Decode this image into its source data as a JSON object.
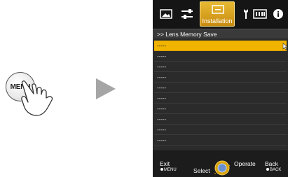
{
  "remote": {
    "menu_button_label": "MENU"
  },
  "osd": {
    "tabs": [
      {
        "icon": "picture-icon"
      },
      {
        "icon": "adjust-sliders-icon"
      },
      {
        "icon": "installation-icon",
        "label": "Installation",
        "active": true
      },
      {
        "icon": "wrench-icon"
      },
      {
        "icon": "display-icon"
      },
      {
        "icon": "info-icon"
      }
    ],
    "title": ">> Lens Memory Save",
    "rows": [
      "-----",
      "-----",
      "-----",
      "-----",
      "-----",
      "-----",
      "-----",
      "-----",
      "-----",
      "-----"
    ],
    "selected_index": 0,
    "footer": {
      "exit_label": "Exit",
      "exit_key": "MENU",
      "select_label": "Select",
      "operate_label": "Operate",
      "back_label": "Back",
      "back_key": "BACK"
    },
    "colors": {
      "highlight": "#f0b400",
      "active_tab": "#e0a820",
      "background": "#2b2b2b"
    }
  }
}
